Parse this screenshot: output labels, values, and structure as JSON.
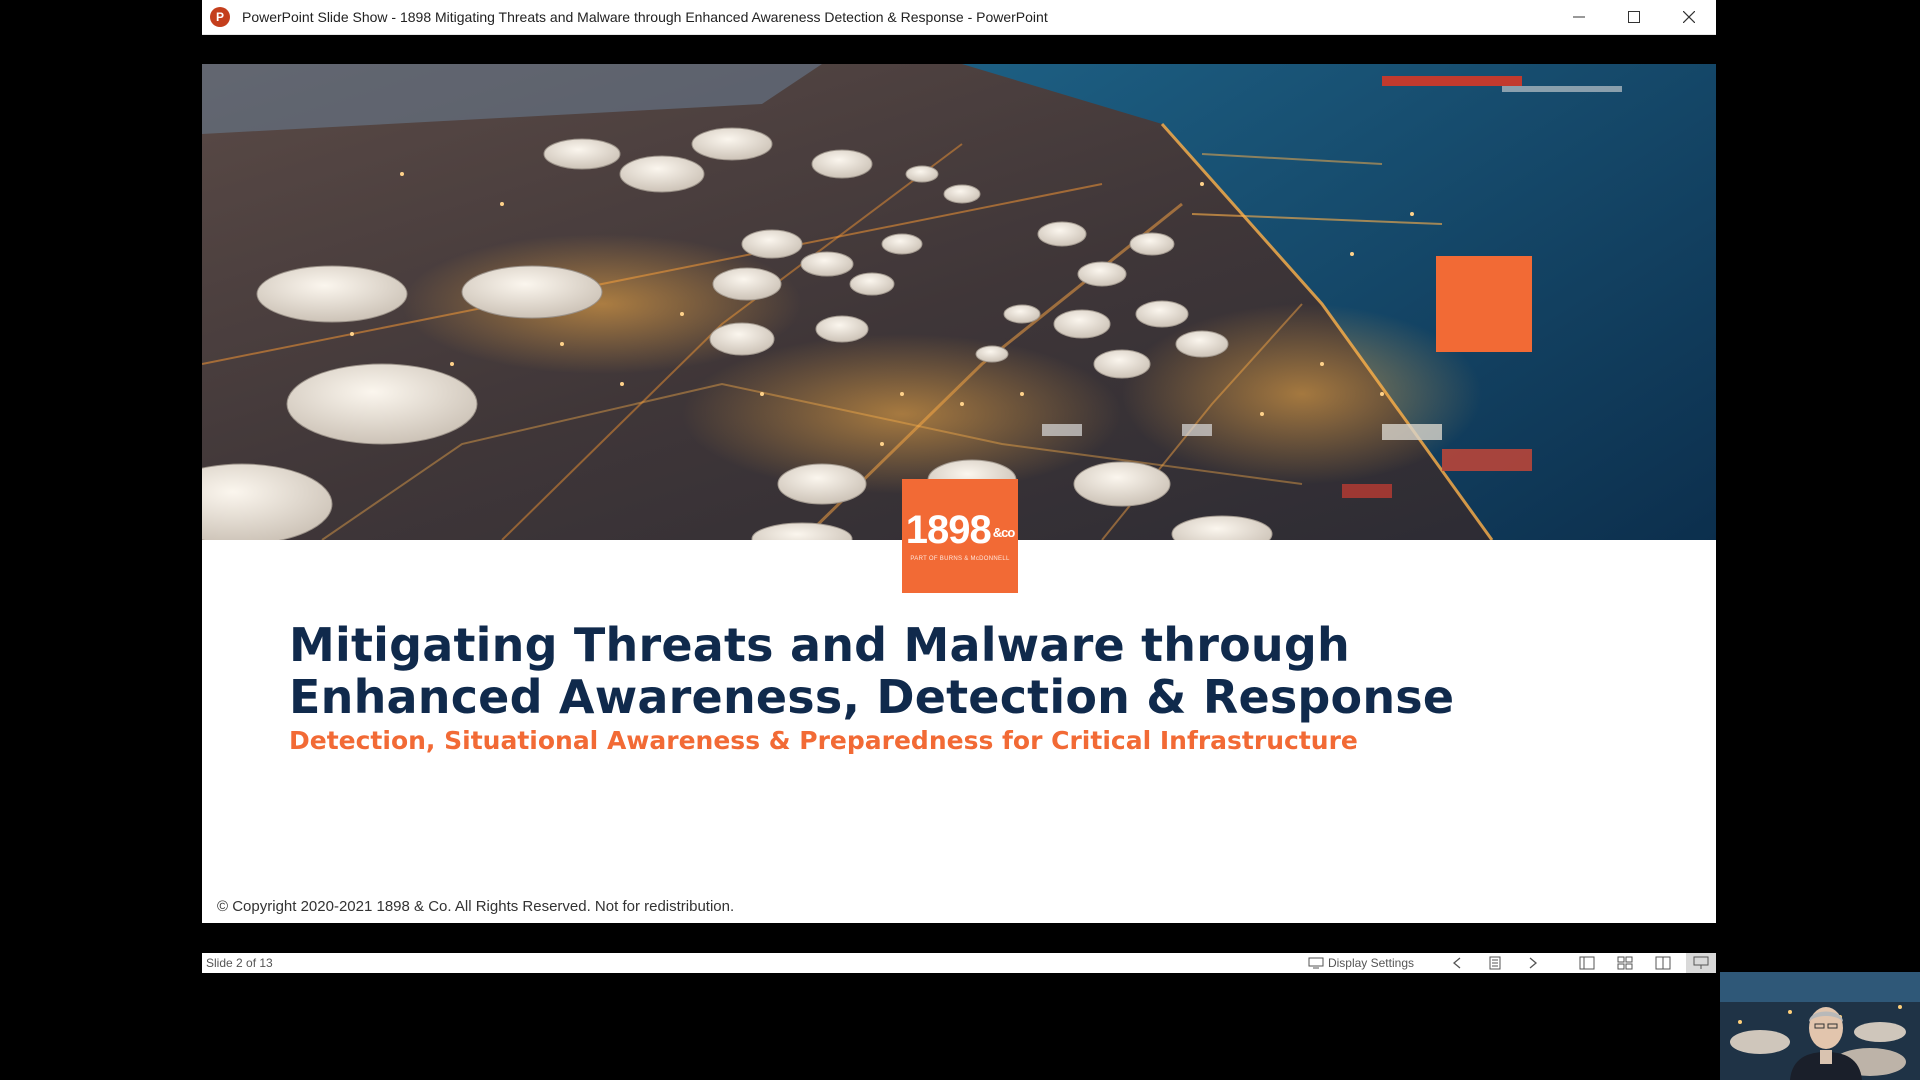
{
  "window": {
    "title": "PowerPoint Slide Show  -  1898 Mitigating Threats and Malware through Enhanced Awareness Detection & Response - PowerPoint",
    "app_icon_letter": "P"
  },
  "slide": {
    "logo_text": "1898",
    "logo_suffix": "&co",
    "logo_tagline": "PART OF BURNS & McDONNELL",
    "title_line1": "Mitigating Threats and Malware through",
    "title_line2": "Enhanced Awareness, Detection & Response",
    "subtitle": "Detection, Situational Awareness & Preparedness for Critical Infrastructure",
    "copyright": "© Copyright 2020-2021 1898 & Co.  All Rights Reserved.  Not for redistribution."
  },
  "statusbar": {
    "slide_count": "Slide 2 of 13",
    "display_settings": "Display Settings"
  },
  "colors": {
    "accent_orange": "#f26a35",
    "title_navy": "#102a4c"
  }
}
